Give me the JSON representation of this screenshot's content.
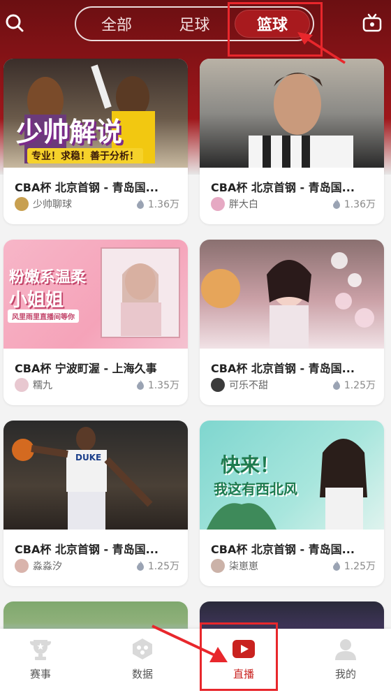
{
  "tabs": [
    {
      "label": "全部",
      "active": false
    },
    {
      "label": "足球",
      "active": false
    },
    {
      "label": "篮球",
      "active": true
    }
  ],
  "header": {
    "left_icon": "search-icon",
    "right_icon": "tv-icon"
  },
  "cards": [
    {
      "title": "CBA杯  北京首钢 - 青岛国...",
      "anchor": "少帅聊球",
      "heat": "1.36万",
      "thumb": {
        "headline": "少帅解说",
        "sub": "专业！求稳！善于分析！"
      }
    },
    {
      "title": "CBA杯 北京首钢 - 青岛国...",
      "anchor": "胖大白",
      "heat": "1.36万",
      "thumb": {}
    },
    {
      "title": "CBA杯  宁波町渥 - 上海久事",
      "anchor": "糯九",
      "heat": "1.35万",
      "thumb": {
        "headline1": "粉嫩系温柔",
        "headline2": "小姐姐",
        "sub": "风里雨里直播间等你"
      }
    },
    {
      "title": "CBA杯  北京首钢 - 青岛国...",
      "anchor": "可乐不甜",
      "heat": "1.25万",
      "thumb": {}
    },
    {
      "title": "CBA杯  北京首钢 - 青岛国...",
      "anchor": "淼淼汐",
      "heat": "1.25万",
      "thumb": {
        "jersey": "DUKE"
      }
    },
    {
      "title": "CBA杯  北京首钢 - 青岛国...",
      "anchor": "柒崽崽",
      "heat": "1.25万",
      "thumb": {
        "headline1": "快来！",
        "headline2": "我这有西北风"
      }
    }
  ],
  "bottom_nav": [
    {
      "label": "赛事",
      "icon": "trophy-icon",
      "active": false
    },
    {
      "label": "数据",
      "icon": "data-cube-icon",
      "active": false
    },
    {
      "label": "直播",
      "icon": "live-play-icon",
      "active": true
    },
    {
      "label": "我的",
      "icon": "profile-icon",
      "active": false
    }
  ],
  "colors": {
    "brand": "#b51c20",
    "active_tab": "#a81a1e",
    "annotation": "#e8272c"
  }
}
